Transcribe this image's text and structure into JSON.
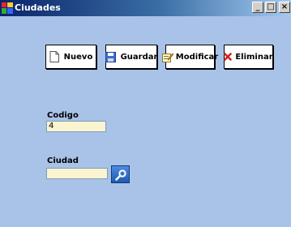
{
  "window": {
    "title": "Ciudades",
    "controls": {
      "minimize": "_",
      "maximize": "□",
      "close": "×"
    }
  },
  "toolbar": {
    "nuevo": {
      "label": "Nuevo",
      "icon": "new-document-icon"
    },
    "guardar": {
      "label": "Guardar",
      "icon": "save-icon"
    },
    "modificar": {
      "label": "Modificar",
      "icon": "edit-icon"
    },
    "eliminar": {
      "label": "Eliminar",
      "icon": "delete-icon"
    }
  },
  "form": {
    "codigo": {
      "label": "Codigo",
      "value": "4"
    },
    "ciudad": {
      "label": "Ciudad",
      "value": ""
    },
    "search_icon": "search-icon"
  },
  "colors": {
    "background": "#a9c2e8",
    "field_background": "#faf4d0",
    "titlebar_start": "#0a246a",
    "delete_red": "#d42020"
  }
}
